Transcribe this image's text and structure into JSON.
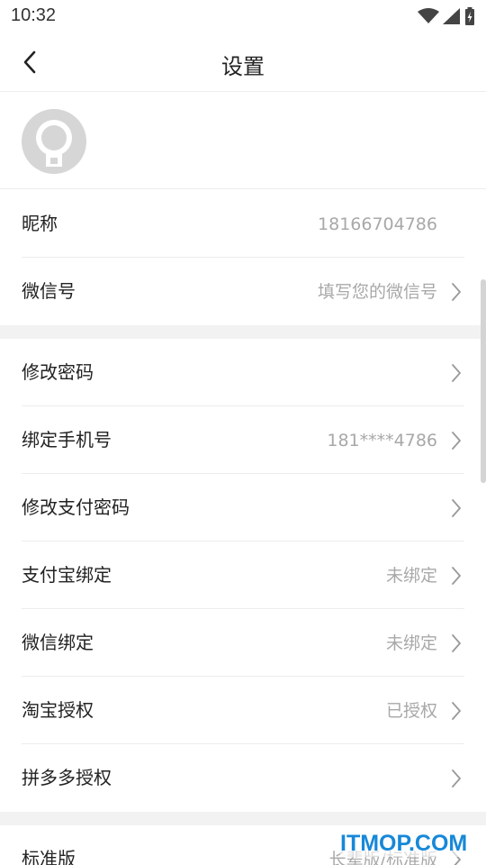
{
  "status_bar": {
    "time": "10:32",
    "icons": [
      "wifi-icon",
      "signal-icon",
      "battery-icon"
    ]
  },
  "nav": {
    "title": "设置",
    "back_icon": "chevron-left-icon"
  },
  "profile": {
    "avatar_icon": "default-avatar-icon"
  },
  "groups": [
    {
      "rows": [
        {
          "label": "昵称",
          "value": "18166704786",
          "arrow": false
        },
        {
          "label": "微信号",
          "value": "填写您的微信号",
          "arrow": true
        }
      ]
    },
    {
      "rows": [
        {
          "label": "修改密码",
          "value": "",
          "arrow": true
        },
        {
          "label": "绑定手机号",
          "value": "181****4786",
          "arrow": true
        },
        {
          "label": "修改支付密码",
          "value": "",
          "arrow": true
        },
        {
          "label": "支付宝绑定",
          "value": "未绑定",
          "arrow": true
        },
        {
          "label": "微信绑定",
          "value": "未绑定",
          "arrow": true
        },
        {
          "label": "淘宝授权",
          "value": "已授权",
          "arrow": true
        },
        {
          "label": "拼多多授权",
          "value": "",
          "arrow": true
        }
      ]
    },
    {
      "rows": [
        {
          "label": "标准版",
          "value": "长辈版/标准版",
          "arrow": true
        }
      ]
    }
  ],
  "watermark": "ITMOP.COM",
  "colors": {
    "text": "#222222",
    "secondary_text": "#a8a8a8",
    "divider": "#ececec",
    "section_gap": "#f2f2f2",
    "watermark": "#1788d8"
  }
}
